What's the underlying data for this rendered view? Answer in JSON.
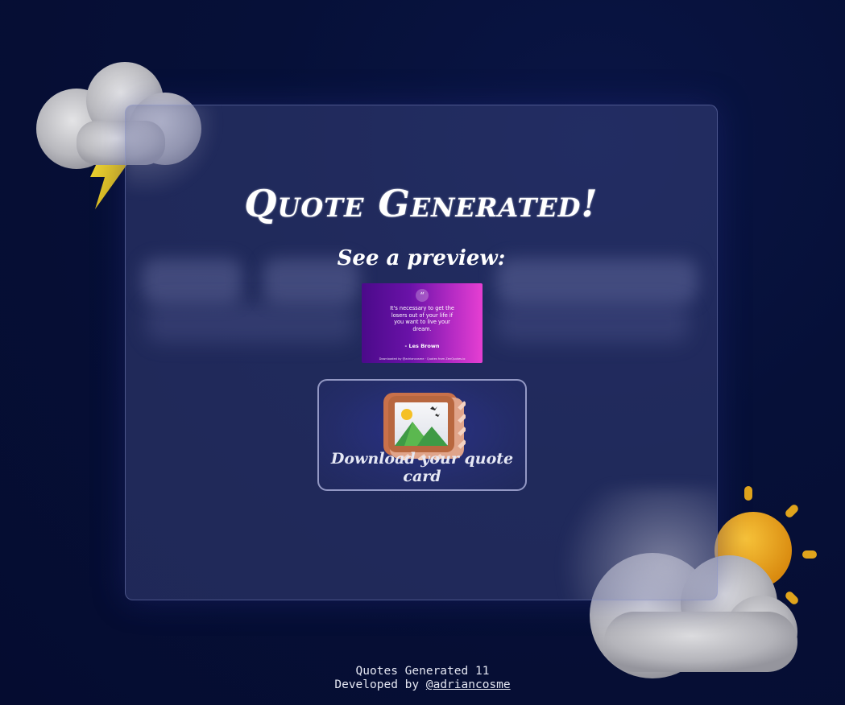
{
  "panel": {
    "title": "Quote Generated!",
    "subtitle": "See a preview:"
  },
  "preview_card": {
    "quote_mark": "“",
    "quote_text": "It's necessary to get the losers out of your life if you want to live your dream.",
    "author": "- Les Brown",
    "footer_text": "Downloaded by @adriancosme · Quotes from ZenQuotes.io",
    "gradient_colors": [
      "#4b0a8a",
      "#e63fd2"
    ]
  },
  "download_button": {
    "label": "Download your quote card",
    "icon": "framed-picture-icon"
  },
  "footer": {
    "counter_label": "Quotes Generated",
    "counter_value": "11",
    "developed_by_label": "Developed by",
    "developer_handle": "@adriancosme"
  },
  "decorations": {
    "top_left": "storm-cloud-icon",
    "bottom_right": "sun-cloud-icon"
  },
  "colors": {
    "background": "#061038",
    "panel": "#464e8c",
    "text": "#ffffff",
    "lightning": "#e5c31a",
    "sun": "#f2a81c"
  }
}
